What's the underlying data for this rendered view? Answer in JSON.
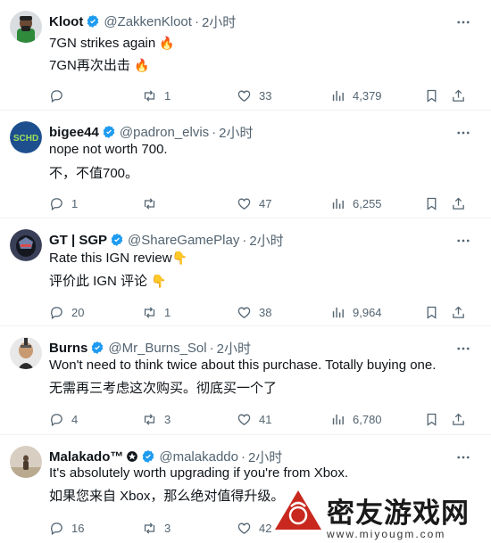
{
  "tweets": [
    {
      "name": "Kloot",
      "handle": "@ZakkenKloot",
      "time": "2小时",
      "text_en": "7GN strikes again",
      "text_zh": "7GN再次出击",
      "emoji_en": "🔥",
      "emoji_zh": "🔥",
      "reply_count": "",
      "retweet_count": "1",
      "like_count": "33",
      "view_count": "4,379",
      "avatar_color": "#d9dde0"
    },
    {
      "name": "bigee44",
      "handle": "@padron_elvis",
      "time": "2小时",
      "text_en": "nope not worth 700.",
      "text_zh": "不，不值700。",
      "emoji_en": "",
      "emoji_zh": "",
      "reply_count": "1",
      "retweet_count": "",
      "like_count": "47",
      "view_count": "6,255",
      "avatar_label": "SCHD",
      "avatar_color": "#1d4f8f"
    },
    {
      "name": "GT | SGP",
      "handle": "@ShareGamePlay",
      "time": "2小时",
      "text_en": "Rate this IGN review",
      "text_zh": "评价此 IGN 评论",
      "emoji_en": "👇",
      "emoji_zh": "👇",
      "reply_count": "20",
      "retweet_count": "1",
      "like_count": "38",
      "view_count": "9,964",
      "avatar_color": "#3a3f58"
    },
    {
      "name": "Burns",
      "handle": "@Mr_Burns_Sol",
      "time": "2小时",
      "text_en": "Won't need to think twice about this purchase. Totally buying one.",
      "text_zh": "无需再三考虑这次购买。彻底买一个了",
      "emoji_en": "",
      "emoji_zh": "",
      "reply_count": "4",
      "retweet_count": "3",
      "like_count": "41",
      "view_count": "6,780",
      "avatar_color": "#e8e8e8"
    },
    {
      "name": "Malakado™",
      "handle": "@malakaddo",
      "time": "2小时",
      "text_en": "It's absolutely worth upgrading if you're from Xbox.",
      "text_zh": "如果您来自 Xbox，那么绝对值得升级。",
      "emoji_en": "",
      "emoji_zh": "",
      "reply_count": "16",
      "retweet_count": "3",
      "like_count": "42",
      "view_count": "",
      "avatar_color": "#d8cfc2"
    }
  ],
  "watermark": {
    "text": "密友游戏网",
    "url": "www.miyougm.com"
  },
  "colors": {
    "text": "#0f1419",
    "secondary": "#536471",
    "verified": "#1d9bf0",
    "divider": "#eff3f4",
    "watermark_red": "#c8281e"
  },
  "icons": [
    "more-icon",
    "reply-icon",
    "retweet-icon",
    "like-icon",
    "views-icon",
    "bookmark-icon",
    "share-icon",
    "verified-icon"
  ]
}
